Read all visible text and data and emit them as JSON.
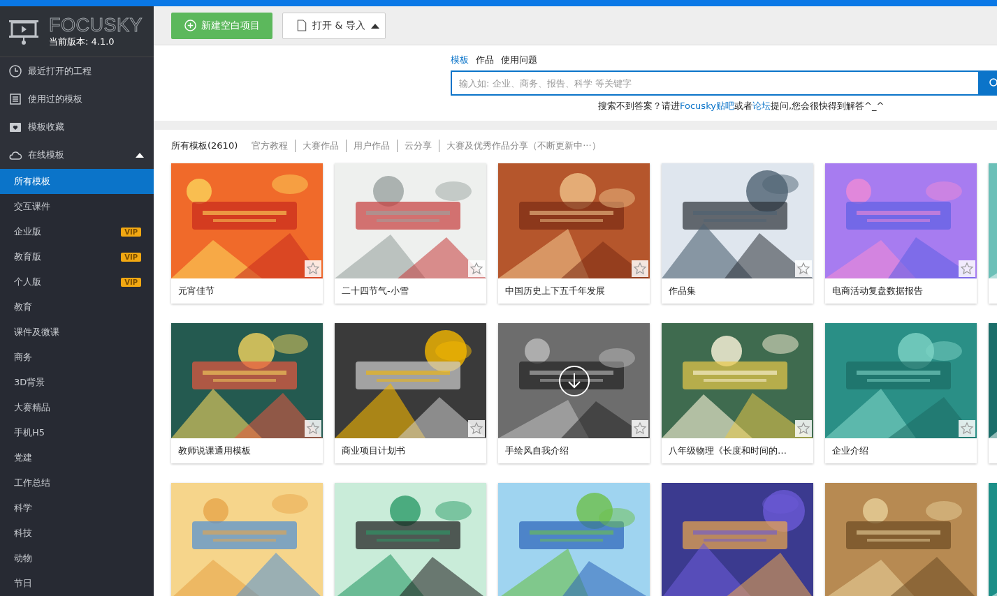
{
  "logo": {
    "name": "FOCUSKY",
    "version": "当前版本: 4.1.0"
  },
  "sidebar": {
    "top_items": [
      {
        "label": "最近打开的工程"
      },
      {
        "label": "使用过的模板"
      },
      {
        "label": "模板收藏"
      },
      {
        "label": "在线模板",
        "expanded": true
      }
    ],
    "categories": [
      {
        "label": "所有模板",
        "selected": true
      },
      {
        "label": "交互课件",
        "selected": false
      },
      {
        "label": "企业版",
        "selected": false,
        "badge": "VIP"
      },
      {
        "label": "教育版",
        "selected": false,
        "badge": "VIP"
      },
      {
        "label": "个人版",
        "selected": false,
        "badge": "VIP"
      },
      {
        "label": "教育",
        "selected": false
      },
      {
        "label": "课件及微课",
        "selected": false
      },
      {
        "label": "商务",
        "selected": false
      },
      {
        "label": "3D背景",
        "selected": false
      },
      {
        "label": "大赛精品",
        "selected": false
      },
      {
        "label": "手机H5",
        "selected": false
      },
      {
        "label": "党建",
        "selected": false
      },
      {
        "label": "工作总结",
        "selected": false
      },
      {
        "label": "科学",
        "selected": false
      },
      {
        "label": "科技",
        "selected": false
      },
      {
        "label": "动物",
        "selected": false
      },
      {
        "label": "节日",
        "selected": false
      }
    ]
  },
  "toolbar": {
    "new_button": "新建空白项目",
    "open_button": "打开 & 导入"
  },
  "search": {
    "tabs": [
      {
        "label": "模板",
        "selected": true
      },
      {
        "label": "作品",
        "selected": false
      },
      {
        "label": "使用问题",
        "selected": false
      }
    ],
    "placeholder": "输入如: 企业、商务、报告、科学 等关键字",
    "help": {
      "lead": "搜索不到答案？请进",
      "link_1": "Focusky贴吧",
      "middle": "或者",
      "link_2": "论坛",
      "tail": "提问,您会很快得到解答^_^"
    }
  },
  "filters": [
    {
      "label": "所有模板(2610)",
      "selected": true
    },
    {
      "label": "官方教程",
      "selected": false
    },
    {
      "label": "大赛作品",
      "selected": false
    },
    {
      "label": "用户作品",
      "selected": false
    },
    {
      "label": "云分享",
      "selected": false
    },
    {
      "label": "大赛及优秀作品分享（不断更新中···）",
      "selected": false
    }
  ],
  "templates": [
    {
      "title": "元宵佳节",
      "download_overlay": false
    },
    {
      "title": "二十四节气-小雪",
      "download_overlay": false
    },
    {
      "title": "中国历史上下五千年发展",
      "download_overlay": false
    },
    {
      "title": "作品集",
      "download_overlay": false
    },
    {
      "title": "电商活动复盘数据报告",
      "download_overlay": false
    },
    {
      "title": "教师说课通用模板",
      "download_overlay": false
    },
    {
      "title": "商业项目计划书",
      "download_overlay": false
    },
    {
      "title": "手绘风自我介绍",
      "download_overlay": true
    },
    {
      "title": "八年级物理《长度和时间的…",
      "download_overlay": false
    },
    {
      "title": "企业介绍",
      "download_overlay": false
    }
  ]
}
